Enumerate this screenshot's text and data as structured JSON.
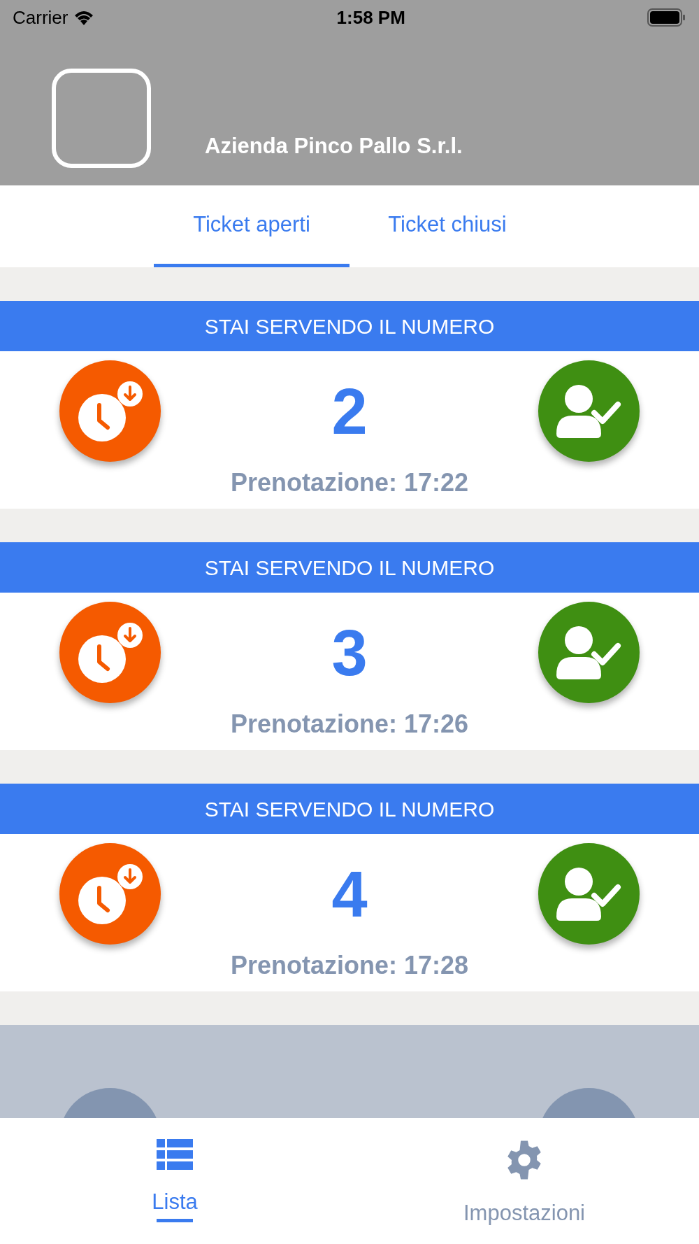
{
  "status_bar": {
    "carrier": "Carrier",
    "time": "1:58 PM"
  },
  "header": {
    "company": "Azienda Pinco Pallo S.r.l."
  },
  "tabs": [
    {
      "label": "Ticket aperti",
      "selected": true
    },
    {
      "label": "Ticket chiusi",
      "selected": false
    }
  ],
  "tickets": [
    {
      "kind": "active",
      "banner": "STAI SERVENDO IL NUMERO",
      "number": "2",
      "booking": "Prenotazione: 17:22"
    },
    {
      "kind": "active",
      "banner": "STAI SERVENDO IL NUMERO",
      "number": "3",
      "booking": "Prenotazione: 17:26"
    },
    {
      "kind": "active",
      "banner": "STAI SERVENDO IL NUMERO",
      "number": "4",
      "booking": "Prenotazione: 17:28"
    },
    {
      "kind": "faded"
    }
  ],
  "bottom_nav": [
    {
      "label": "Lista",
      "kind": "list",
      "selected": true
    },
    {
      "label": "Impostazioni",
      "kind": "settings",
      "selected": false
    }
  ]
}
